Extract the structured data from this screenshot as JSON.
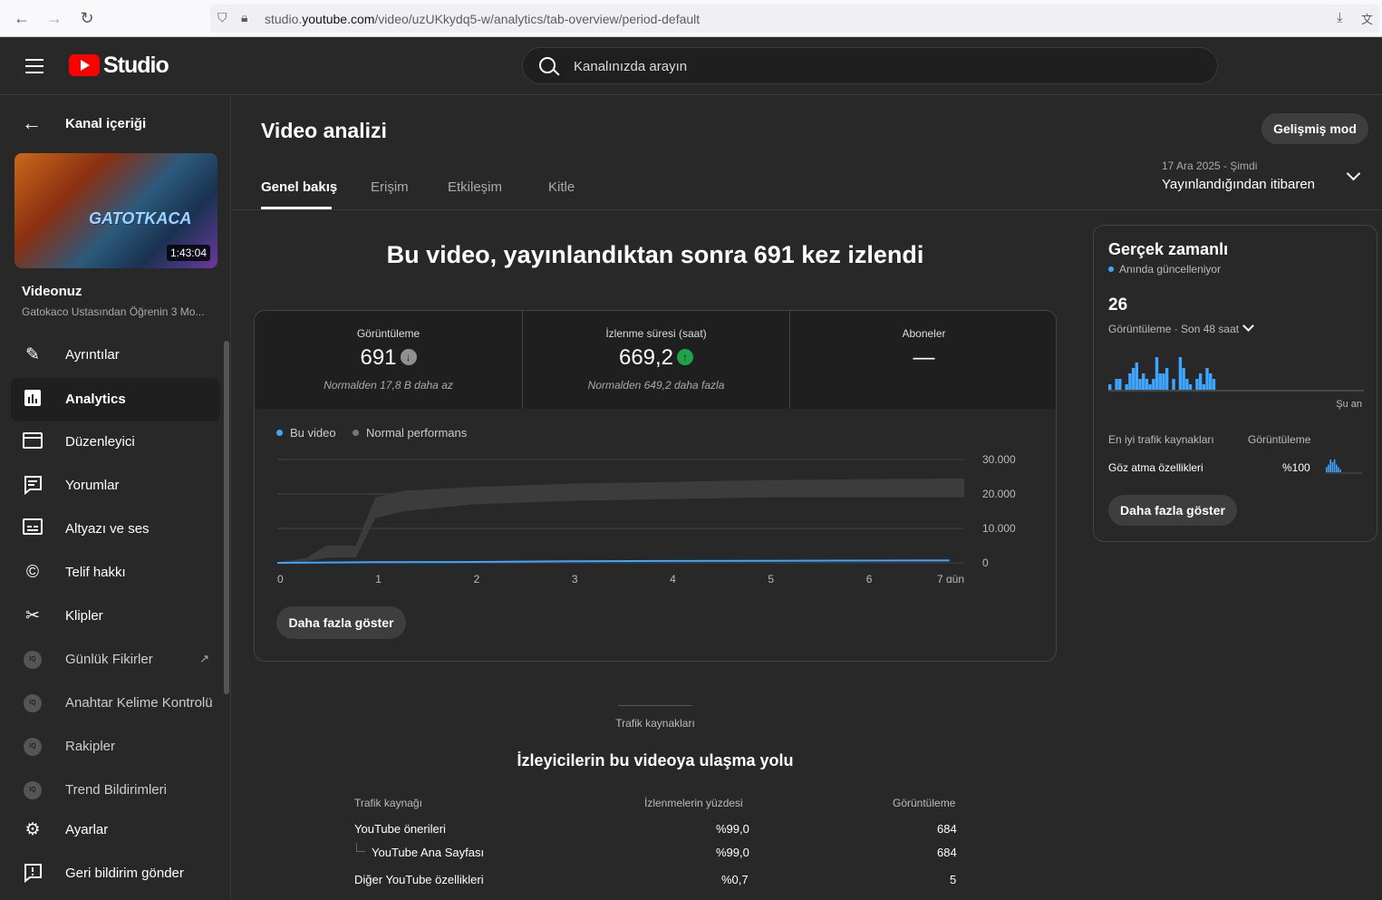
{
  "browser": {
    "url_prefix": "studio.",
    "url_domain": "youtube.com",
    "url_path": "/video/uzUKkydq5-w/analytics/tab-overview/period-default"
  },
  "header": {
    "logo_text": "Studio",
    "search_placeholder": "Kanalınızda arayın"
  },
  "sidebar": {
    "back_label": "Kanal içeriği",
    "thumb_title": "GATOTKACA",
    "duration": "1:43:04",
    "video_label": "Videonuz",
    "video_title": "Gatokaco Ustasından Öğrenin 3 Mo...",
    "items": [
      {
        "label": "Ayrıntılar",
        "icon": "pencil-icon"
      },
      {
        "label": "Analytics",
        "icon": "analytics-icon"
      },
      {
        "label": "Düzenleyici",
        "icon": "editor-icon"
      },
      {
        "label": "Yorumlar",
        "icon": "comments-icon"
      },
      {
        "label": "Altyazı ve ses",
        "icon": "subtitles-icon"
      },
      {
        "label": "Telif hakkı",
        "icon": "copyright-icon"
      },
      {
        "label": "Klipler",
        "icon": "scissors-icon"
      },
      {
        "label": "Günlük Fikirler",
        "icon": "vidiq-icon"
      },
      {
        "label": "Anahtar Kelime Kontrolü",
        "icon": "vidiq-icon"
      },
      {
        "label": "Rakipler",
        "icon": "vidiq-icon"
      },
      {
        "label": "Trend Bildirimleri",
        "icon": "vidiq-icon"
      },
      {
        "label": "Ayarlar",
        "icon": "gear-icon"
      },
      {
        "label": "Geri bildirim gönder",
        "icon": "feedback-icon"
      }
    ],
    "ext_badge": "IQ"
  },
  "main": {
    "title": "Video analizi",
    "advanced_button": "Gelişmiş mod",
    "tabs": [
      "Genel bakış",
      "Erişim",
      "Etkileşim",
      "Kitle"
    ],
    "period_date": "17 Ara 2025 - Şimdi",
    "period_label": "Yayınlandığından itibaren",
    "headline": "Bu video, yayınlandıktan sonra 691 kez izlendi",
    "stats": [
      {
        "label": "Görüntüleme",
        "value": "691",
        "trend": "down",
        "note": "Normalden 17,8 B daha az"
      },
      {
        "label": "İzlenme süresi (saat)",
        "value": "669,2",
        "trend": "up",
        "note": "Normalden 649,2 daha fazla"
      },
      {
        "label": "Aboneler",
        "value": "—",
        "note": ""
      }
    ],
    "legend": [
      "Bu video",
      "Normal performans"
    ],
    "more_button": "Daha fazla göster"
  },
  "chart_data": {
    "type": "area",
    "x": [
      0,
      1,
      2,
      3,
      4,
      5,
      6,
      7
    ],
    "x_tick_labels": [
      "0",
      "1",
      "2",
      "3",
      "4",
      "5",
      "6",
      "7 gün"
    ],
    "y_tick_labels": [
      "0",
      "10.000",
      "20.000",
      "30.000"
    ],
    "ylim": [
      0,
      30000
    ],
    "series": [
      {
        "name": "Bu video",
        "type": "line",
        "x": [
          0,
          1,
          2,
          3,
          4,
          5,
          6,
          6.85
        ],
        "values": [
          0,
          200,
          250,
          450,
          550,
          600,
          650,
          691
        ]
      },
      {
        "name": "Normal performans",
        "type": "band",
        "x": [
          0,
          0.3,
          0.5,
          0.8,
          1.0,
          1.3,
          2,
          3,
          4,
          5,
          6,
          7
        ],
        "lower": [
          0,
          400,
          1500,
          1600,
          13000,
          15000,
          17000,
          18000,
          18500,
          19000,
          19000,
          19000
        ],
        "upper": [
          0,
          1500,
          5000,
          5000,
          19000,
          21000,
          22000,
          23000,
          23500,
          24000,
          24300,
          24500
        ]
      }
    ],
    "grid": true,
    "legend_position": "top-left",
    "colors": {
      "line": "#3ea6ff",
      "band": "#3c3c3c",
      "grid": "#444444"
    }
  },
  "realtime": {
    "title": "Gerçek zamanlı",
    "subtitle": "Anında güncelleniyor",
    "count": "26",
    "period": "Görüntüleme · Son 48 saat",
    "now_label": "Şu an",
    "bars": [
      1,
      0,
      2,
      2,
      0,
      1,
      3,
      4,
      5,
      2,
      3,
      2,
      1,
      2,
      6,
      3,
      3,
      4,
      0,
      2,
      0,
      6,
      4,
      2,
      1,
      0,
      2,
      3,
      1,
      4,
      3,
      2
    ],
    "col1": "En iyi trafik kaynakları",
    "col2": "Görüntüleme",
    "source": "Göz atma özellikleri",
    "share": "%100",
    "mini_bars": [
      2,
      3,
      5,
      4,
      5,
      3,
      2,
      1
    ],
    "button": "Daha fazla göster"
  },
  "traffic": {
    "small_title": "Trafik kaynakları",
    "title": "İzleyicilerin bu videoya ulaşma yolu",
    "headers": [
      "Trafik kaynağı",
      "İzlenmelerin yüzdesi",
      "Görüntüleme"
    ],
    "rows": [
      {
        "source": "YouTube önerileri",
        "pct": "%99,0",
        "views": "684"
      },
      {
        "source": "YouTube Ana Sayfası",
        "pct": "%99,0",
        "views": "684"
      },
      {
        "source": "Diğer YouTube özellikleri",
        "pct": "%0,7",
        "views": "5"
      }
    ]
  },
  "colors": {
    "accent": "#3ea6ff",
    "brand": "#ff0000",
    "positive": "#1fa24a"
  }
}
